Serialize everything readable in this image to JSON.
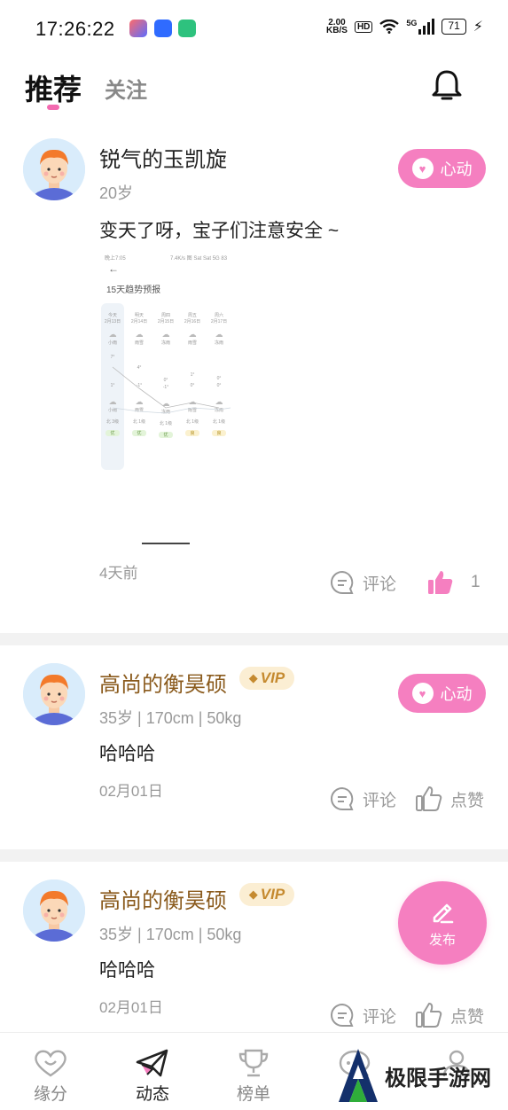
{
  "status_bar": {
    "time": "17:26:22",
    "net_speed_value": "2.00",
    "net_speed_unit": "KB/S",
    "hd": "HD",
    "signal_label": "5G",
    "battery": "71"
  },
  "header": {
    "tab_recommend": "推荐",
    "tab_follow": "关注",
    "notification_icon": "bell-icon"
  },
  "posts": [
    {
      "name": "锐气的玉凯旋",
      "vip": false,
      "meta": "20岁",
      "content": "变天了呀，宝子们注意安全 ~",
      "date": "4天前",
      "heart_label": "心动",
      "comment_label": "评论",
      "like_label": "1",
      "liked": true,
      "image": {
        "header_left": "晚上7:05",
        "header_right": "7.4K/s 图 Sat Sat 5G 83",
        "back": "←",
        "title": "15天趋势预报",
        "columns": [
          {
            "day": "今天",
            "date": "2月13日",
            "weather_top": "小雨",
            "high": "7°",
            "low": "1°",
            "weather_bottom": "小雨",
            "wind": "北 3级",
            "aqi": "优"
          },
          {
            "day": "明天",
            "date": "2月14日",
            "weather_top": "雨雪",
            "high": "4°",
            "low": "-1°",
            "weather_bottom": "雨雪",
            "wind": "北 1级",
            "aqi": "优"
          },
          {
            "day": "周四",
            "date": "2月15日",
            "weather_top": "冻雨",
            "high": "0°",
            "low": "-1°",
            "weather_bottom": "冻雨",
            "wind": "北 1级",
            "aqi": "优"
          },
          {
            "day": "周五",
            "date": "2月16日",
            "weather_top": "雨雪",
            "high": "1°",
            "low": "0°",
            "weather_bottom": "雨雪",
            "wind": "北 1级",
            "aqi": "良"
          },
          {
            "day": "周六",
            "date": "2月17日",
            "weather_top": "冻雨",
            "high": "0°",
            "low": "0°",
            "weather_bottom": "冻雨",
            "wind": "北 1级",
            "aqi": "良"
          }
        ]
      }
    },
    {
      "name": "高尚的衡昊硕",
      "vip": true,
      "vip_label": "VIP",
      "meta": "35岁 | 170cm | 50kg",
      "content": "哈哈哈",
      "date": "02月01日",
      "heart_label": "心动",
      "comment_label": "评论",
      "like_label": "点赞",
      "liked": false
    },
    {
      "name": "高尚的衡昊硕",
      "vip": true,
      "vip_label": "VIP",
      "meta": "35岁 | 170cm | 50kg",
      "content": "哈哈哈",
      "date": "02月01日",
      "comment_label": "评论",
      "like_label": "点赞",
      "liked": false
    }
  ],
  "fab": {
    "label": "发布",
    "icon": "pencil-icon"
  },
  "bottom_nav": [
    {
      "label": "缘分",
      "icon": "heart-outline-icon",
      "active": false
    },
    {
      "label": "动态",
      "icon": "paper-plane-icon",
      "active": true
    },
    {
      "label": "榜单",
      "icon": "trophy-icon",
      "active": false
    },
    {
      "label": "",
      "icon": "chat-icon",
      "active": false
    },
    {
      "label": "",
      "icon": "profile-icon",
      "active": false
    }
  ],
  "watermark": {
    "text": "极限手游网"
  },
  "colors": {
    "accent_pink": "#f57fc0",
    "vip_gold": "#c58a2f",
    "vip_name": "#8a5a1c",
    "muted_text": "#999999"
  }
}
